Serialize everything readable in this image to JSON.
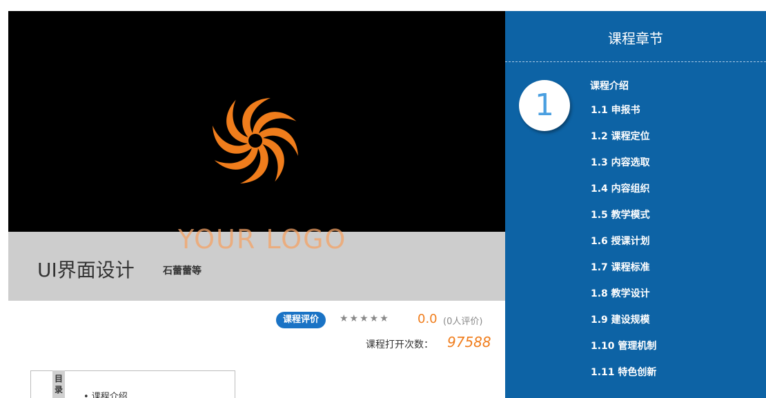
{
  "course": {
    "title": "UI界面设计",
    "author": "石蕾蕾等",
    "logo_text": "YOUR LOGO",
    "logo_color": "#f07d1c"
  },
  "rating": {
    "label": "课程评价",
    "stars": "★★★★★",
    "score": "0.0",
    "reviews": "(0人评价)"
  },
  "stats": {
    "open_label": "课程打开次数：",
    "open_count": "97588"
  },
  "toc": {
    "tab_label": "目录",
    "first_item": "• 课程介绍"
  },
  "sidebar": {
    "title": "课程章节",
    "chapter_number": "1",
    "chapter_name": "课程介绍",
    "accent": "#0d63a5",
    "lessons": [
      "1.1  申报书",
      "1.2  课程定位",
      "1.3  内容选取",
      "1.4  内容组织",
      "1.5  教学模式",
      "1.6  授课计划",
      "1.7  课程标准",
      "1.8  教学设计",
      "1.9  建设规模",
      "1.10  管理机制",
      "1.11  特色创新"
    ]
  }
}
